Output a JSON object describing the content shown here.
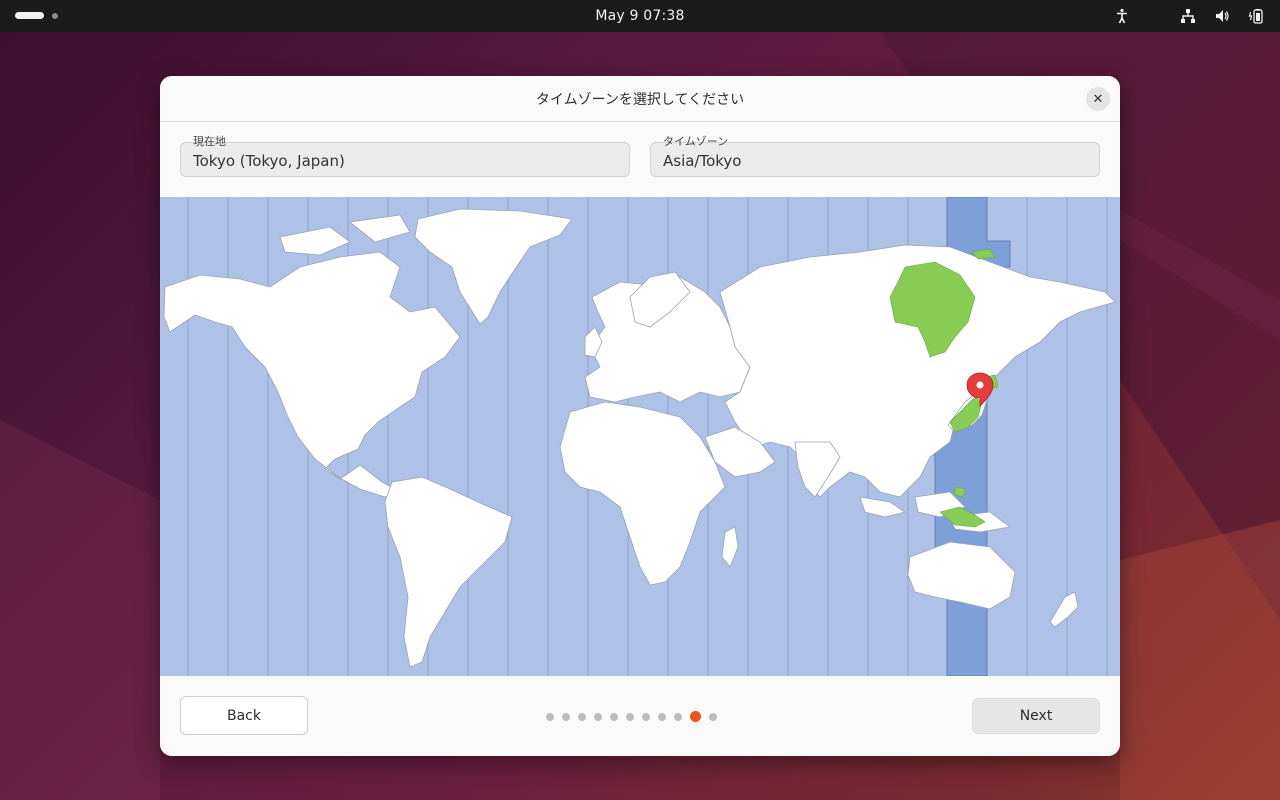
{
  "topbar": {
    "clock": "May 9  07:38",
    "icons": [
      "accessibility-icon",
      "network-icon",
      "volume-icon",
      "battery-icon"
    ]
  },
  "dialog": {
    "title": "タイムゾーンを選択してください",
    "location": {
      "label": "現在地",
      "value": "Tokyo (Tokyo, Japan)"
    },
    "timezone": {
      "label": "タイムゾーン",
      "value": "Asia/Tokyo"
    },
    "map": {
      "selected_marker": "Tokyo",
      "highlight_color": "#86cc55",
      "band_color": "#7f9fd9",
      "ocean_color": "#aec1e6"
    },
    "back_label": "Back",
    "next_label": "Next",
    "pager": {
      "total": 11,
      "current": 10,
      "accent": "#e95420"
    }
  }
}
